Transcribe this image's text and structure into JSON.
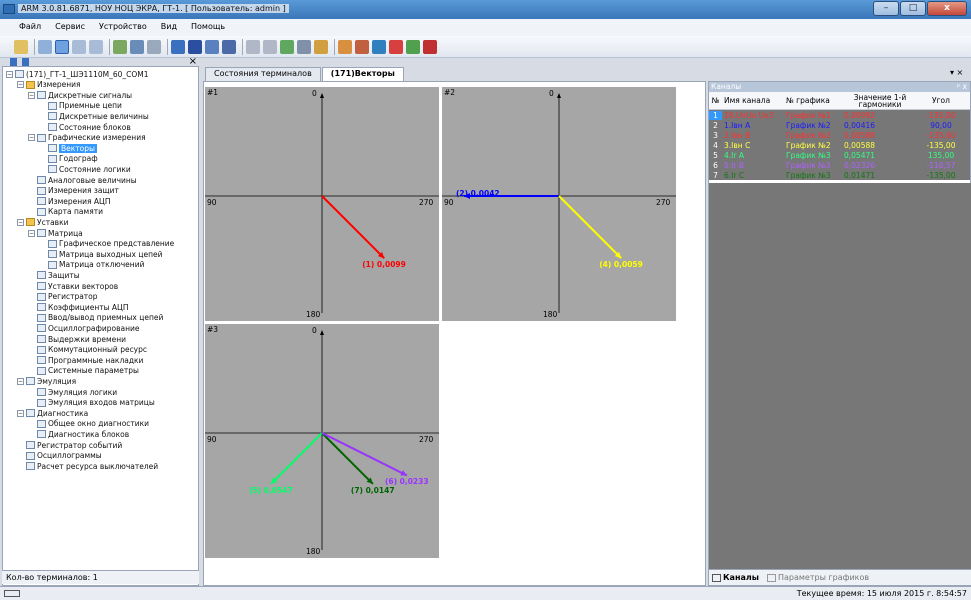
{
  "window": {
    "title": "ARM 3.0.81.6871, НОУ НОЦ ЭКРА, ГТ-1. [ Пользователь: admin ]",
    "controls": {
      "minimize": "–",
      "maximize": "□",
      "close": "x"
    }
  },
  "menu": {
    "items": [
      "Файл",
      "Сервис",
      "Устройство",
      "Вид",
      "Помощь"
    ]
  },
  "left_panel": {
    "close_glyph": "×",
    "tree": [
      {
        "label": "(171)_ГТ-1_ШЭ1110М_60_COM1",
        "level": 0,
        "expanded": true,
        "icon": "device-icon"
      },
      {
        "label": "Измерения",
        "level": 1,
        "expanded": true,
        "icon": "folder-icon"
      },
      {
        "label": "Дискретные сигналы",
        "level": 2,
        "expanded": true,
        "icon": "table-icon"
      },
      {
        "label": "Приемные цепи",
        "level": 3,
        "icon": "table-icon"
      },
      {
        "label": "Дискретные величины",
        "level": 3,
        "icon": "table-icon"
      },
      {
        "label": "Состояние блоков",
        "level": 3,
        "icon": "table-icon"
      },
      {
        "label": "Графические измерения",
        "level": 2,
        "expanded": true,
        "icon": "chart-icon"
      },
      {
        "label": "Векторы",
        "level": 3,
        "selected": true,
        "icon": "table-icon"
      },
      {
        "label": "Годограф",
        "level": 3,
        "icon": "table-icon"
      },
      {
        "label": "Состояние логики",
        "level": 3,
        "icon": "table-icon"
      },
      {
        "label": "Аналоговые величины",
        "level": 2,
        "icon": "table-icon"
      },
      {
        "label": "Измерения защит",
        "level": 2,
        "icon": "table-icon"
      },
      {
        "label": "Измерения АЦП",
        "level": 2,
        "icon": "table-icon"
      },
      {
        "label": "Карта памяти",
        "level": 2,
        "icon": "table-icon"
      },
      {
        "label": "Уставки",
        "level": 1,
        "expanded": true,
        "icon": "folder-icon"
      },
      {
        "label": "Матрица",
        "level": 2,
        "expanded": true,
        "icon": "matrix-icon"
      },
      {
        "label": "Графическое представление",
        "level": 3,
        "icon": "table-icon"
      },
      {
        "label": "Матрица выходных цепей",
        "level": 3,
        "icon": "table-icon"
      },
      {
        "label": "Матрица отключений",
        "level": 3,
        "icon": "table-icon"
      },
      {
        "label": "Защиты",
        "level": 2,
        "icon": "table-icon"
      },
      {
        "label": "Уставки векторов",
        "level": 2,
        "icon": "table-icon"
      },
      {
        "label": "Регистратор",
        "level": 2,
        "icon": "table-icon"
      },
      {
        "label": "Коэффициенты АЦП",
        "level": 2,
        "icon": "table-icon"
      },
      {
        "label": "Ввод/вывод приемных цепей",
        "level": 2,
        "icon": "table-icon"
      },
      {
        "label": "Осциллографирование",
        "level": 2,
        "icon": "table-icon"
      },
      {
        "label": "Выдержки времени",
        "level": 2,
        "icon": "table-icon"
      },
      {
        "label": "Коммутационный ресурс",
        "level": 2,
        "icon": "table-icon"
      },
      {
        "label": "Программные накладки",
        "level": 2,
        "icon": "table-icon"
      },
      {
        "label": "Системные параметры",
        "level": 2,
        "icon": "table-icon"
      },
      {
        "label": "Эмуляция",
        "level": 1,
        "expanded": true,
        "icon": "gear-icon"
      },
      {
        "label": "Эмуляция логики",
        "level": 2,
        "icon": "table-icon"
      },
      {
        "label": "Эмуляция входов матрицы",
        "level": 2,
        "icon": "table-icon"
      },
      {
        "label": "Диагностика",
        "level": 1,
        "expanded": true,
        "icon": "diag-icon"
      },
      {
        "label": "Общее окно диагностики",
        "level": 2,
        "icon": "table-icon"
      },
      {
        "label": "Диагностика блоков",
        "level": 2,
        "icon": "table-icon"
      },
      {
        "label": "Регистратор событий",
        "level": 1,
        "icon": "events-icon"
      },
      {
        "label": "Осциллограммы",
        "level": 1,
        "icon": "osc-icon"
      },
      {
        "label": "Расчет ресурса выключателей",
        "level": 1,
        "icon": "table-icon"
      }
    ],
    "terminal_count": "Кол-во терминалов: 1"
  },
  "tabs": [
    {
      "label": "Состояния терминалов",
      "active": false
    },
    {
      "label": "(171)Векторы",
      "active": true
    }
  ],
  "plots": [
    {
      "id": "#1",
      "top": "0",
      "bottom": "180",
      "left": "90",
      "right": "270",
      "vectors": [
        {
          "label": "(1) 0,0099",
          "color": "#ff0000",
          "angle": -135,
          "len": 0.88
        }
      ]
    },
    {
      "id": "#2",
      "top": "0",
      "bottom": "180",
      "left": "90",
      "right": "270",
      "vectors": [
        {
          "label": "(2) 0,0042",
          "color": "#0000ff",
          "angle": 90,
          "len": 0.95
        },
        {
          "label": "(4) 0,0059",
          "color": "#ffff00",
          "angle": -135,
          "len": 0.88
        }
      ]
    },
    {
      "id": "#3",
      "top": "0",
      "bottom": "180",
      "left": "90",
      "right": "270",
      "vectors": [
        {
          "label": "(5) 0,0547",
          "color": "#00ff66",
          "angle": 135,
          "len": 0.72
        },
        {
          "label": "(7) 0,0147",
          "color": "#006400",
          "angle": -135,
          "len": 0.72
        },
        {
          "label": "(6) 0,0233",
          "color": "#9933ff",
          "angle": -116.57,
          "len": 0.95
        }
      ]
    }
  ],
  "channels_panel": {
    "title": "Каналы",
    "pin": "ᵖ x",
    "headers": [
      "№",
      "Имя канала",
      "№ графика",
      "Значение 1-й гармоники",
      "Угол"
    ],
    "rows": [
      {
        "n": "1",
        "name": "18.UnUo Uo3",
        "graph": "График №1",
        "value": "0,00992",
        "angle": "-135,00",
        "color": "#ff3030",
        "selected": true
      },
      {
        "n": "2",
        "name": "1.Iвн A",
        "graph": "График №2",
        "value": "0,00416",
        "angle": "90,00",
        "color": "#1a1aff"
      },
      {
        "n": "3",
        "name": "2.Iвн B",
        "graph": "График №2",
        "value": "0,00588",
        "angle": "-135,00",
        "color": "#ff3030"
      },
      {
        "n": "4",
        "name": "3.Iвн C",
        "graph": "График №2",
        "value": "0,00588",
        "angle": "-135,00",
        "color": "#ffff40"
      },
      {
        "n": "5",
        "name": "4.Ir A",
        "graph": "График №3",
        "value": "0,05471",
        "angle": "135,00",
        "color": "#30ff80"
      },
      {
        "n": "6",
        "name": "5.Ir B",
        "graph": "График №3",
        "value": "0,02326",
        "angle": "-116,57",
        "color": "#b060ff"
      },
      {
        "n": "7",
        "name": "6.Ir C",
        "graph": "График №3",
        "value": "0,01471",
        "angle": "-135,00",
        "color": "#0f7a0f"
      }
    ],
    "bottom_tabs": [
      "Каналы",
      "Параметры графиков"
    ]
  },
  "status": {
    "time": "Текущее время: 15 июля 2015 г. 8:54:57"
  }
}
